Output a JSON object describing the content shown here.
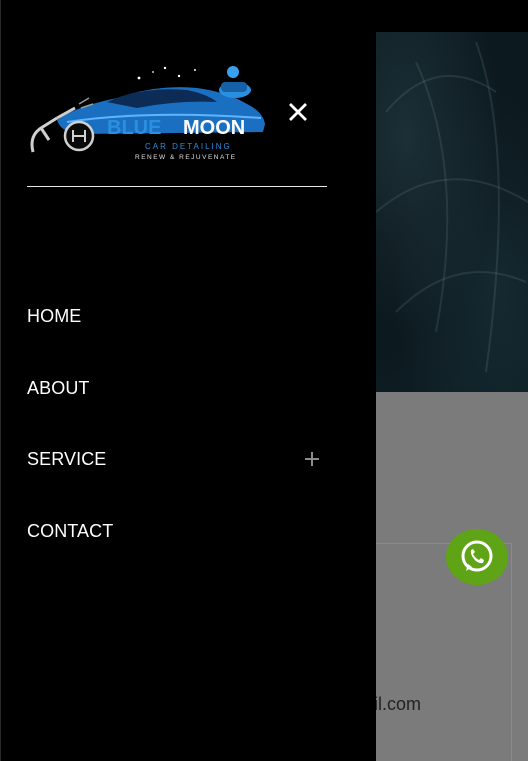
{
  "brand": {
    "name_part1": "BLUE",
    "name_part2": "MOON",
    "subtitle": "CAR DETAILING",
    "tagline": "RENEW & REJUVENATE"
  },
  "menu": {
    "items": [
      {
        "label": "HOME",
        "has_submenu": false
      },
      {
        "label": "ABOUT",
        "has_submenu": false
      },
      {
        "label": "SERVICE",
        "has_submenu": true
      },
      {
        "label": "CONTACT",
        "has_submenu": false
      }
    ]
  },
  "background": {
    "email_fragment": "ail.com"
  },
  "colors": {
    "drawer_bg": "#000000",
    "accent_blue": "#2a8fe0",
    "whatsapp_green": "#5fa316"
  },
  "icons": {
    "close": "close-icon",
    "expand": "plus-icon",
    "whatsapp": "whatsapp-icon"
  }
}
